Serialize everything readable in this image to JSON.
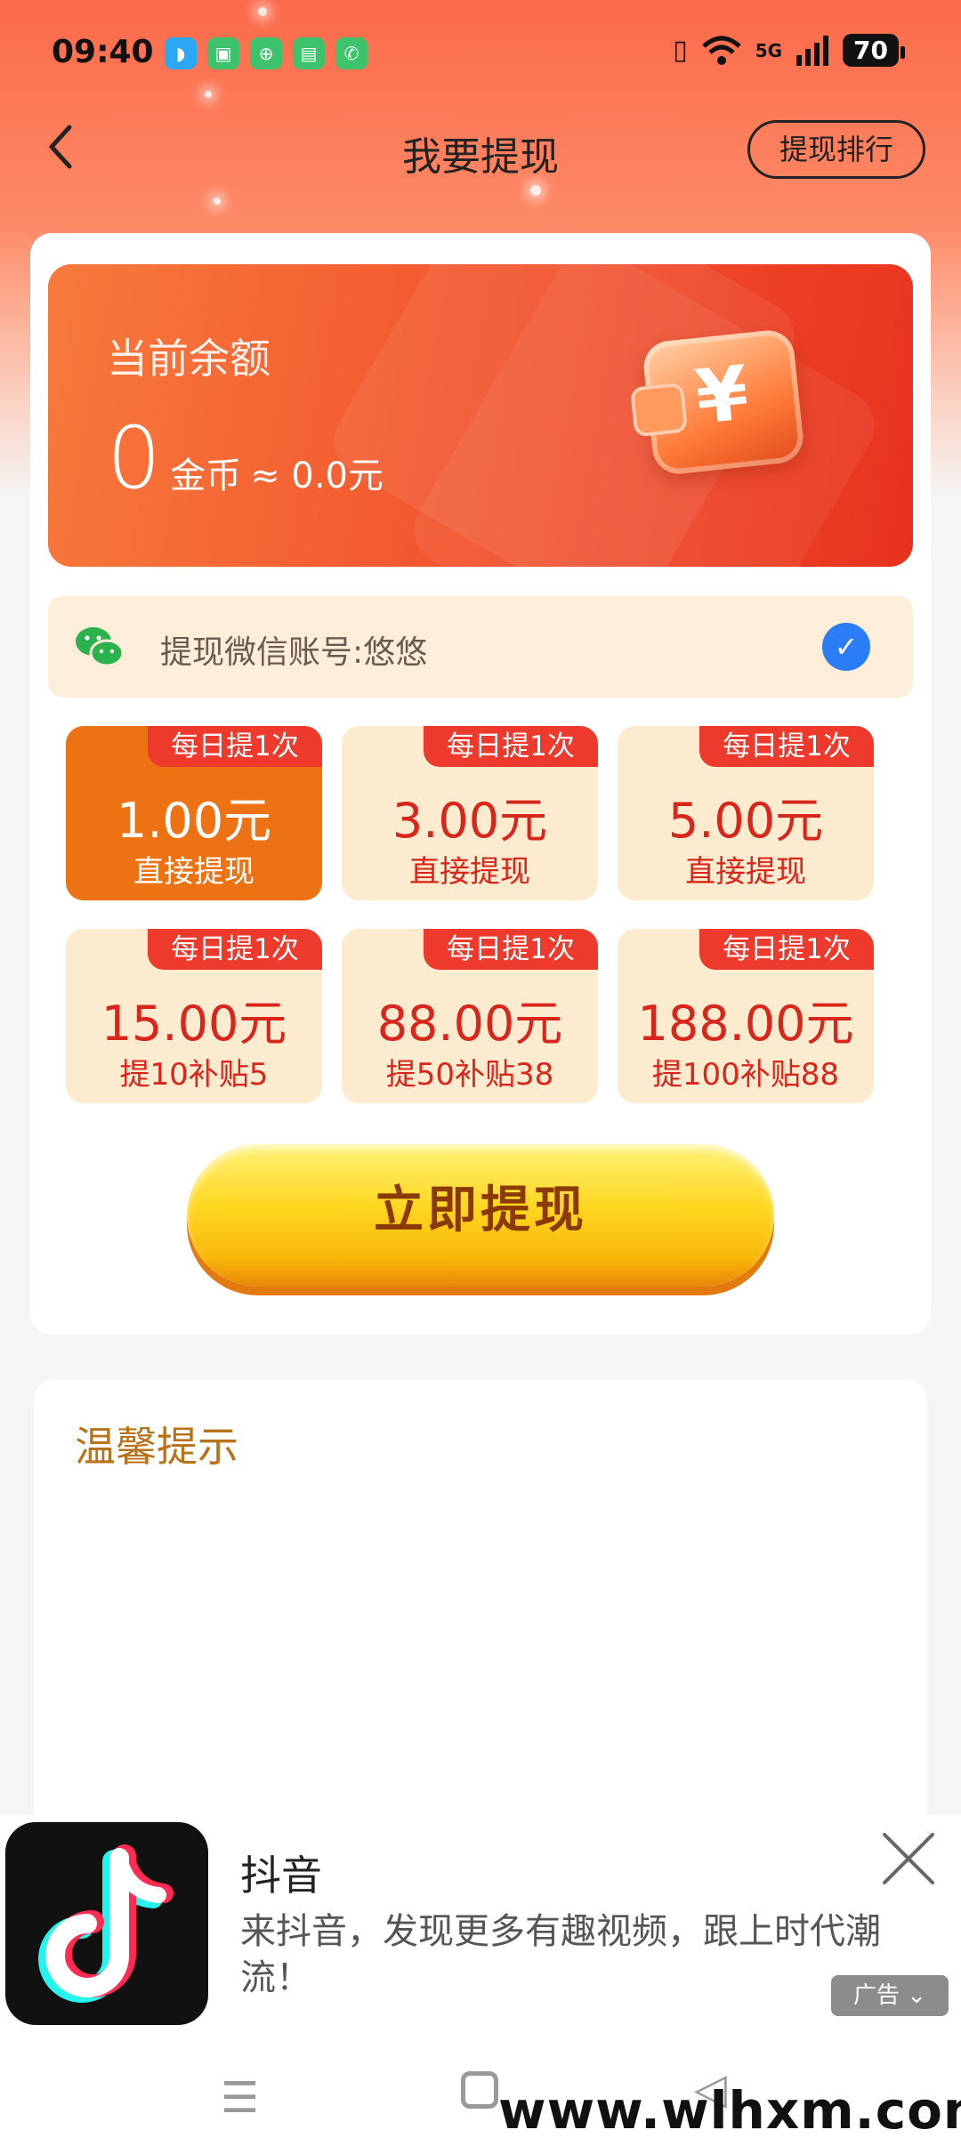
{
  "status_bar": {
    "time": "09:40",
    "network": "5G",
    "battery": "70"
  },
  "header": {
    "title": "我要提现",
    "rank_button": "提现排行"
  },
  "balance": {
    "label": "当前余额",
    "amount": "0",
    "unit": "金币",
    "approx": "≈ 0.0元"
  },
  "wechat": {
    "account_text": "提现微信账号:悠悠"
  },
  "options": [
    {
      "tag": "每日提1次",
      "amount": "1.00元",
      "desc": "直接提现",
      "selected": true
    },
    {
      "tag": "每日提1次",
      "amount": "3.00元",
      "desc": "直接提现",
      "selected": false
    },
    {
      "tag": "每日提1次",
      "amount": "5.00元",
      "desc": "直接提现",
      "selected": false
    },
    {
      "tag": "每日提1次",
      "amount": "15.00元",
      "desc": "提10补贴5",
      "selected": false
    },
    {
      "tag": "每日提1次",
      "amount": "88.00元",
      "desc": "提50补贴38",
      "selected": false
    },
    {
      "tag": "每日提1次",
      "amount": "188.00元",
      "desc": "提100补贴88",
      "selected": false
    }
  ],
  "withdraw_button": "立即提现",
  "tips": {
    "title": "温馨提示"
  },
  "ad": {
    "title": "抖音",
    "description": "来抖音，发现更多有趣视频，跟上时代潮流！",
    "badge": "广告"
  },
  "watermark": "www.wlhxm.com",
  "colors": {
    "accent": "#ed7214",
    "tag_red": "#ee3a2c",
    "amount_red": "#d8261c",
    "button_yellow": "#ffd61f"
  }
}
